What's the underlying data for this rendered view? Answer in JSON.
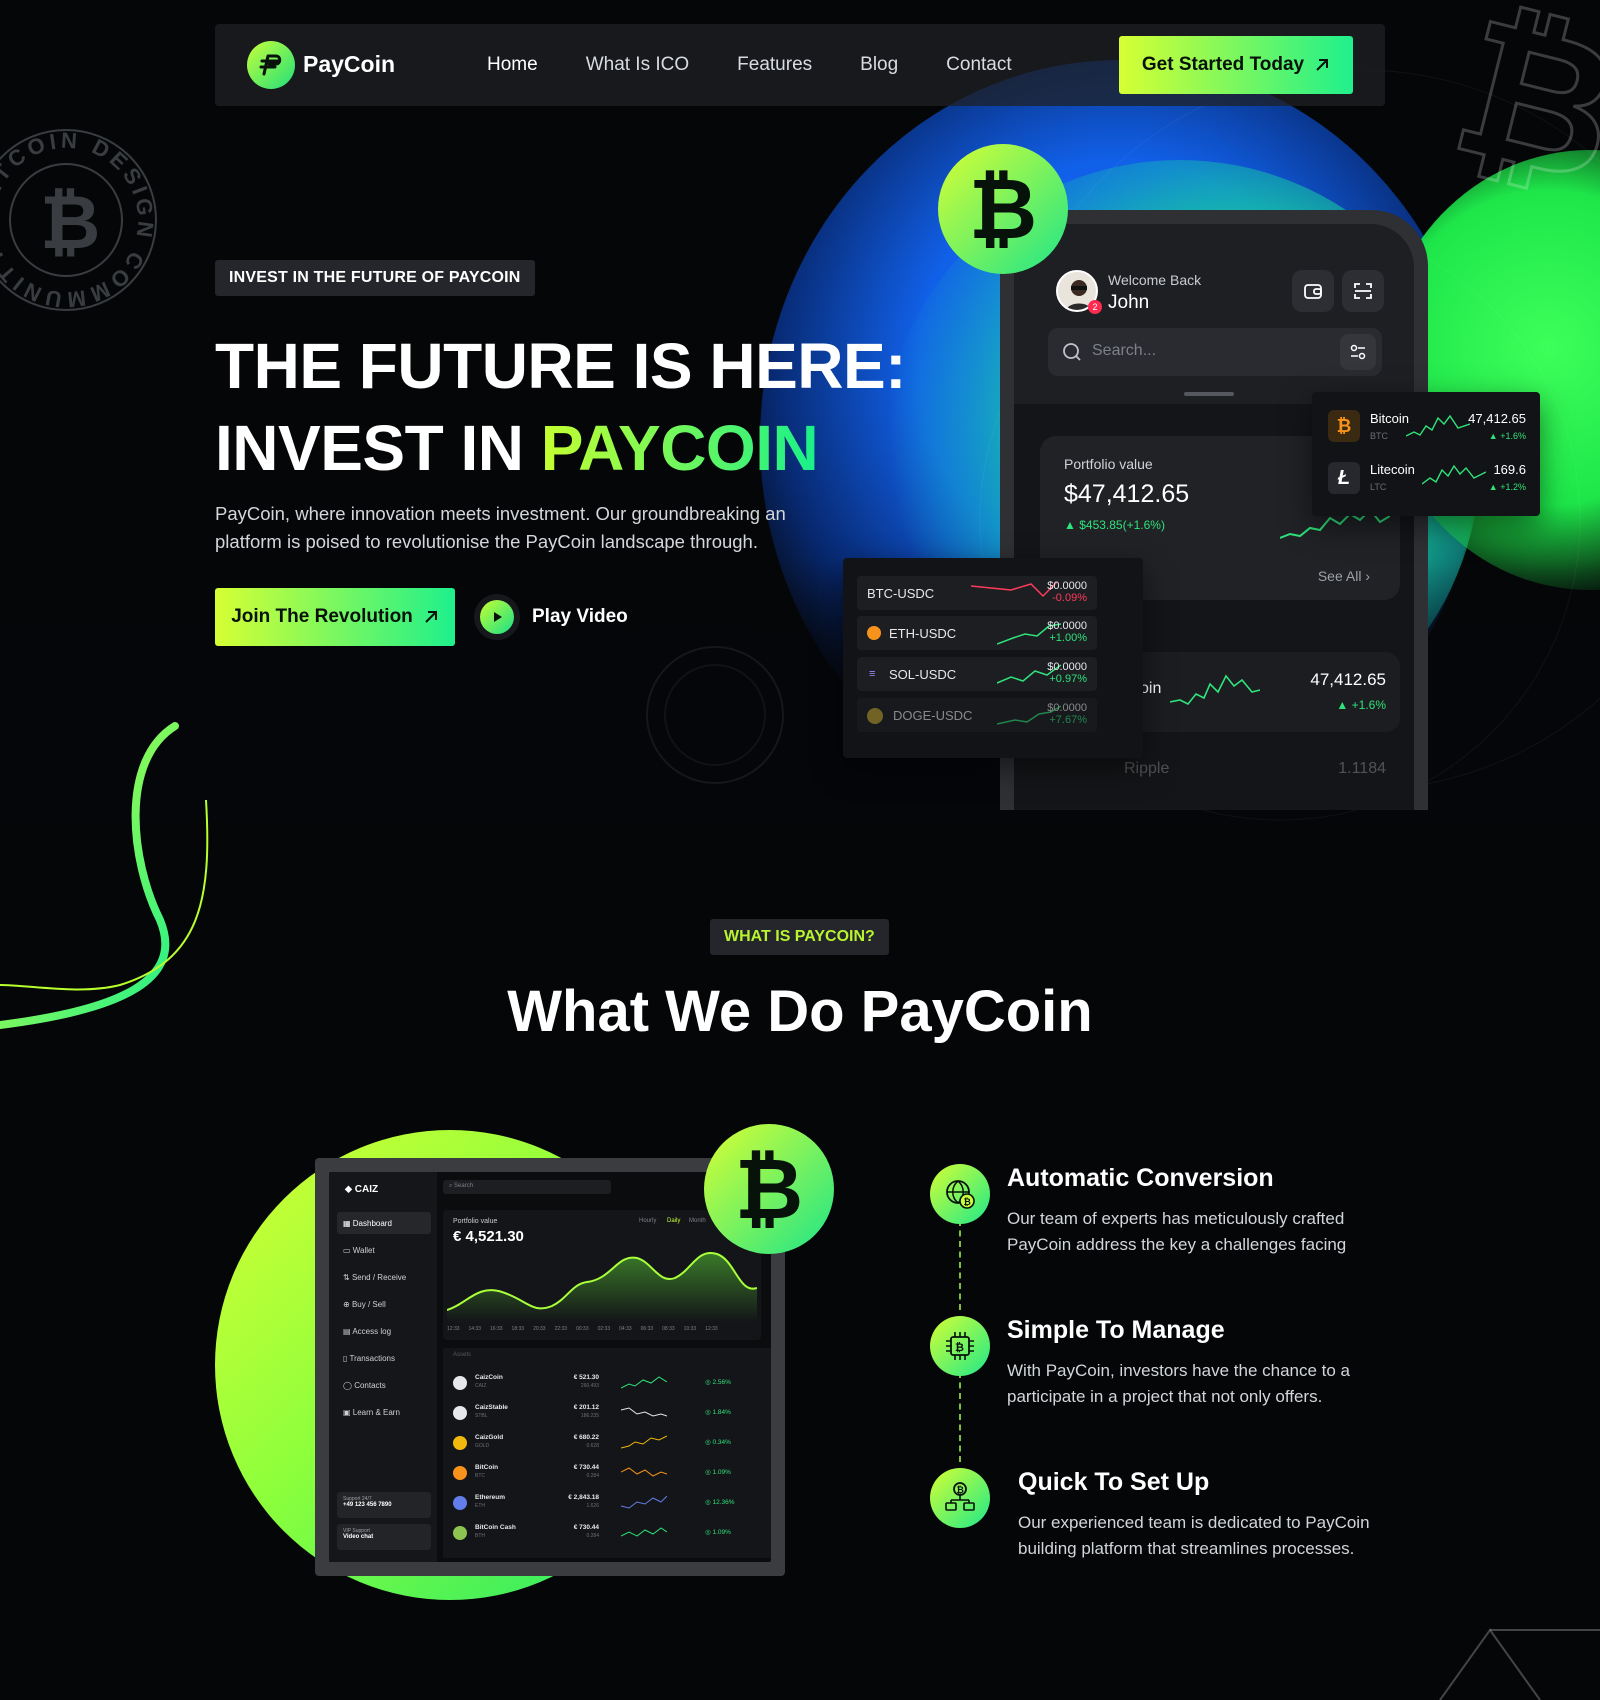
{
  "brand": {
    "name": "PayCoin",
    "accent_start": "#d6ff33",
    "accent_end": "#1ff08c"
  },
  "nav": {
    "links": [
      "Home",
      "What Is ICO",
      "Features",
      "Blog",
      "Contact"
    ],
    "cta_label": "Get Started Today"
  },
  "hero": {
    "tag": "INVEST IN THE FUTURE OF PAYCOIN",
    "title_line1": "THE FUTURE IS HERE:",
    "title_line2_prefix": "INVEST IN ",
    "title_line2_highlight": "PAYCOIN",
    "subtitle": "PayCoin, where innovation meets investment. Our groundbreaking an platform is poised to revolutionise the PayCoin landscape through.",
    "primary_button": "Join The Revolution",
    "video_button": "Play Video",
    "badge_text": "BITCOIN DESIGN COMMUNITY"
  },
  "phone": {
    "welcome": "Welcome Back",
    "user_name": "John",
    "notification_count": "2",
    "search_placeholder": "Search...",
    "portfolio_label": "Portfolio value",
    "portfolio_value": "$47,412.65",
    "portfolio_change": "$453.85(+1.6%)",
    "see_all": "See All",
    "row_name": "oin",
    "row_value": "47,412.65",
    "row_change": "+1.6%",
    "ripple_name": "Ripple",
    "ripple_value": "1.1184"
  },
  "ticker_card": [
    {
      "name": "Bitcoin",
      "symbol": "BTC",
      "value": "47,412.65",
      "change": "+1.6%",
      "icon": "bitcoin-icon",
      "color": "#f7931a"
    },
    {
      "name": "Litecoin",
      "symbol": "LTC",
      "value": "169.6",
      "change": "+1.2%",
      "icon": "litecoin-icon",
      "color": "#ffffff"
    }
  ],
  "pairs_card": [
    {
      "pair": "BTC-USDC",
      "price": "$0.0000",
      "change": "-0.09%",
      "trend": "down"
    },
    {
      "pair": "ETH-USDC",
      "price": "$0.0000",
      "change": "+1.00%",
      "trend": "up"
    },
    {
      "pair": "SOL-USDC",
      "price": "$0.0000",
      "change": "+0.97%",
      "trend": "up"
    },
    {
      "pair": "DOGE-USDC",
      "price": "$0.0000",
      "change": "+7.67%",
      "trend": "up"
    }
  ],
  "section2": {
    "tag": "WHAT IS PAYCOIN?",
    "title": "What We Do PayCoin"
  },
  "dashboard": {
    "logo": "CAIZ",
    "search": "Search",
    "portfolio_label": "Portfolio value",
    "portfolio_value": "€ 4,521.30",
    "ranges": [
      "Hourly",
      "Daily",
      "Month"
    ],
    "time_ticks": [
      "12:33",
      "14:33",
      "16:33",
      "18:33",
      "20:33",
      "22:33",
      "00:33",
      "02:33",
      "04:33",
      "06:33",
      "08:33",
      "10:33",
      "12:33"
    ],
    "sidebar": [
      "Dashboard",
      "Wallet",
      "Send / Receive",
      "Buy / Sell",
      "Access log",
      "Transactions",
      "Contacts",
      "Learn & Earn"
    ],
    "support_label": "Support 24/7",
    "support_phone": "+49 123 456 7890",
    "vip_label": "VIP Support",
    "vip_text": "Video chat",
    "assets_label": "Assets",
    "assets": [
      {
        "name": "CaizCoin",
        "sym": "CAIZ",
        "value": "€ 521.30",
        "sub": "260.493",
        "change": "2.56%",
        "color": "#e6e8ec"
      },
      {
        "name": "CaizStable",
        "sym": "STBL",
        "value": "€ 201.12",
        "sub": "186.235",
        "change": "1.84%",
        "color": "#e6e8ec"
      },
      {
        "name": "CaizGold",
        "sym": "GOLD",
        "value": "€ 680.22",
        "sub": "0.628",
        "change": "0.34%",
        "color": "#f0b90b"
      },
      {
        "name": "BitCoin",
        "sym": "BTC",
        "value": "€ 730.44",
        "sub": "0.284",
        "change": "1.09%",
        "color": "#f7931a"
      },
      {
        "name": "Ethereum",
        "sym": "ETH",
        "value": "€ 2,843.18",
        "sub": "1.626",
        "change": "12.36%",
        "color": "#627eea"
      },
      {
        "name": "BitCoin Cash",
        "sym": "BTH",
        "value": "€ 730.44",
        "sub": "0.284",
        "change": "1.09%",
        "color": "#8dc351"
      }
    ]
  },
  "features": [
    {
      "title": "Automatic Conversion",
      "text": "Our team of experts has meticulously crafted PayCoin address the key a challenges facing",
      "icon": "globe-bitcoin-icon"
    },
    {
      "title": "Simple To Manage",
      "text": "With PayCoin, investors have the chance to a participate in a project that not only offers.",
      "icon": "chip-bitcoin-icon"
    },
    {
      "title": "Quick To Set Up",
      "text": "Our experienced team is dedicated to PayCoin building platform that streamlines processes.",
      "icon": "network-bitcoin-icon"
    }
  ]
}
